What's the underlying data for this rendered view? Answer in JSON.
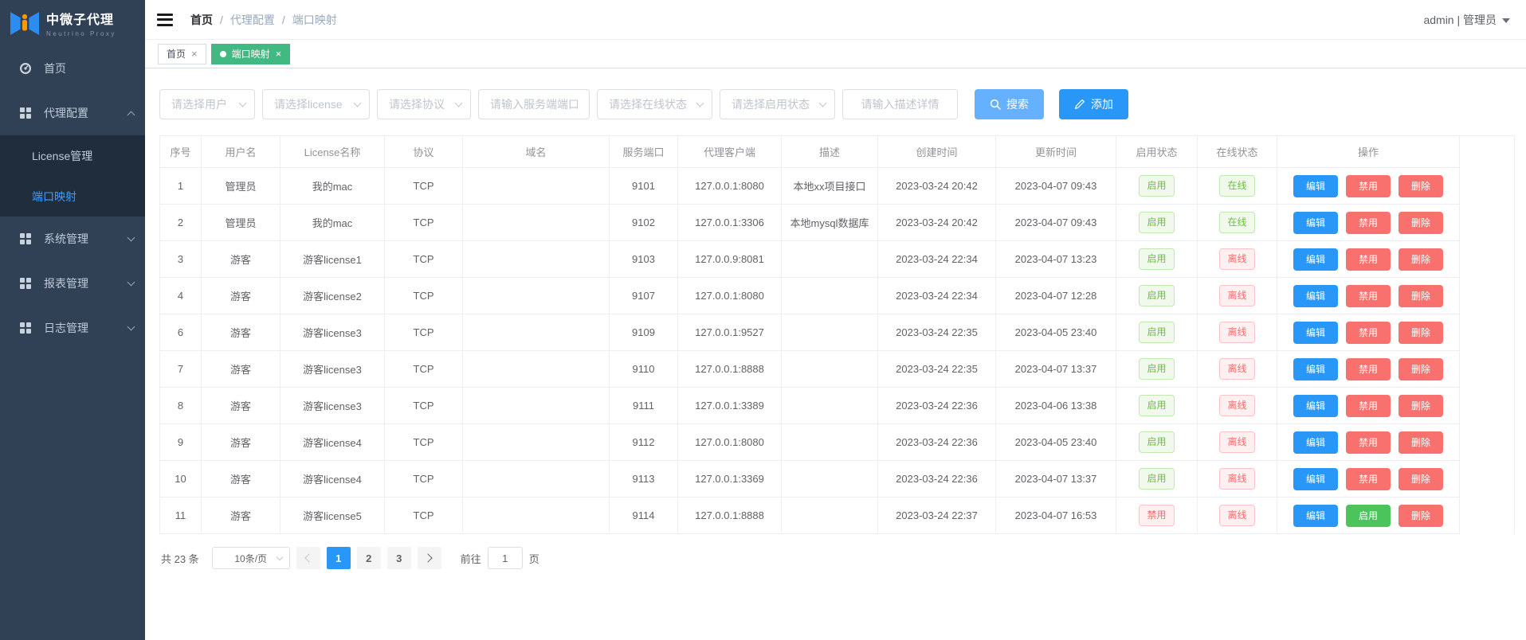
{
  "app": {
    "logo_title": "中微子代理",
    "logo_subtitle": "Neutrino Proxy",
    "user": "admin | 管理员"
  },
  "colors": {
    "sidebar_bg": "#304156",
    "submenu_bg": "#1f2d3d",
    "active_menu": "#409eff",
    "active_tab_green": "#42b983",
    "primary_blue": "#2997f7",
    "success_green": "#67c23a",
    "danger_red": "#f56c6c"
  },
  "sidebar": {
    "items": [
      {
        "label": "首页",
        "icon": "dashboard-icon"
      },
      {
        "label": "代理配置",
        "icon": "grid-icon",
        "children": [
          {
            "label": "License管理"
          },
          {
            "label": "端口映射"
          }
        ]
      },
      {
        "label": "系统管理",
        "icon": "grid-icon"
      },
      {
        "label": "报表管理",
        "icon": "grid-icon"
      },
      {
        "label": "日志管理",
        "icon": "grid-icon"
      }
    ]
  },
  "breadcrumb": {
    "items": [
      "首页",
      "代理配置",
      "端口映射"
    ],
    "separator": "/"
  },
  "tabs": [
    {
      "label": "首页",
      "close": "×"
    },
    {
      "label": "端口映射",
      "close": "×"
    }
  ],
  "filters": {
    "user_placeholder": "请选择用户",
    "license_placeholder": "请选择license",
    "protocol_placeholder": "请选择协议",
    "server_port_placeholder": "请输入服务端端口",
    "online_status_placeholder": "请选择在线状态",
    "enable_status_placeholder": "请选择启用状态",
    "description_placeholder": "请输入描述详情",
    "search_label": "搜索",
    "add_label": "添加"
  },
  "table": {
    "headers": [
      "序号",
      "用户名",
      "License名称",
      "协议",
      "域名",
      "服务端口",
      "代理客户端",
      "描述",
      "创建时间",
      "更新时间",
      "启用状态",
      "在线状态",
      "操作"
    ],
    "rows": [
      {
        "seq": "1",
        "user": "管理员",
        "license": "我的mac",
        "protocol": "TCP",
        "domain": "",
        "server_port": "9101",
        "client": "127.0.0.1:8080",
        "desc": "本地xx项目接口",
        "created": "2023-03-24 20:42",
        "updated": "2023-04-07 09:43",
        "enable_status": "启用",
        "enable_type": "green",
        "online_status": "在线",
        "online_type": "green",
        "actions": [
          {
            "label": "编辑",
            "type": "blue",
            "name": "edit"
          },
          {
            "label": "禁用",
            "type": "red",
            "name": "disable"
          },
          {
            "label": "删除",
            "type": "red",
            "name": "delete"
          }
        ]
      },
      {
        "seq": "2",
        "user": "管理员",
        "license": "我的mac",
        "protocol": "TCP",
        "domain": "",
        "server_port": "9102",
        "client": "127.0.0.1:3306",
        "desc": "本地mysql数据库",
        "created": "2023-03-24 20:42",
        "updated": "2023-04-07 09:43",
        "enable_status": "启用",
        "enable_type": "green",
        "online_status": "在线",
        "online_type": "green",
        "actions": [
          {
            "label": "编辑",
            "type": "blue",
            "name": "edit"
          },
          {
            "label": "禁用",
            "type": "red",
            "name": "disable"
          },
          {
            "label": "删除",
            "type": "red",
            "name": "delete"
          }
        ]
      },
      {
        "seq": "3",
        "user": "游客",
        "license": "游客license1",
        "protocol": "TCP",
        "domain": "",
        "server_port": "9103",
        "client": "127.0.0.9:8081",
        "desc": "",
        "created": "2023-03-24 22:34",
        "updated": "2023-04-07 13:23",
        "enable_status": "启用",
        "enable_type": "green",
        "online_status": "离线",
        "online_type": "red",
        "actions": [
          {
            "label": "编辑",
            "type": "blue",
            "name": "edit"
          },
          {
            "label": "禁用",
            "type": "red",
            "name": "disable"
          },
          {
            "label": "删除",
            "type": "red",
            "name": "delete"
          }
        ]
      },
      {
        "seq": "4",
        "user": "游客",
        "license": "游客license2",
        "protocol": "TCP",
        "domain": "",
        "server_port": "9107",
        "client": "127.0.0.1:8080",
        "desc": "",
        "created": "2023-03-24 22:34",
        "updated": "2023-04-07 12:28",
        "enable_status": "启用",
        "enable_type": "green",
        "online_status": "离线",
        "online_type": "red",
        "actions": [
          {
            "label": "编辑",
            "type": "blue",
            "name": "edit"
          },
          {
            "label": "禁用",
            "type": "red",
            "name": "disable"
          },
          {
            "label": "删除",
            "type": "red",
            "name": "delete"
          }
        ]
      },
      {
        "seq": "6",
        "user": "游客",
        "license": "游客license3",
        "protocol": "TCP",
        "domain": "",
        "server_port": "9109",
        "client": "127.0.0.1:9527",
        "desc": "",
        "created": "2023-03-24 22:35",
        "updated": "2023-04-05 23:40",
        "enable_status": "启用",
        "enable_type": "green",
        "online_status": "离线",
        "online_type": "red",
        "actions": [
          {
            "label": "编辑",
            "type": "blue",
            "name": "edit"
          },
          {
            "label": "禁用",
            "type": "red",
            "name": "disable"
          },
          {
            "label": "删除",
            "type": "red",
            "name": "delete"
          }
        ]
      },
      {
        "seq": "7",
        "user": "游客",
        "license": "游客license3",
        "protocol": "TCP",
        "domain": "",
        "server_port": "9110",
        "client": "127.0.0.1:8888",
        "desc": "",
        "created": "2023-03-24 22:35",
        "updated": "2023-04-07 13:37",
        "enable_status": "启用",
        "enable_type": "green",
        "online_status": "离线",
        "online_type": "red",
        "actions": [
          {
            "label": "编辑",
            "type": "blue",
            "name": "edit"
          },
          {
            "label": "禁用",
            "type": "red",
            "name": "disable"
          },
          {
            "label": "删除",
            "type": "red",
            "name": "delete"
          }
        ]
      },
      {
        "seq": "8",
        "user": "游客",
        "license": "游客license3",
        "protocol": "TCP",
        "domain": "",
        "server_port": "9111",
        "client": "127.0.0.1:3389",
        "desc": "",
        "created": "2023-03-24 22:36",
        "updated": "2023-04-06 13:38",
        "enable_status": "启用",
        "enable_type": "green",
        "online_status": "离线",
        "online_type": "red",
        "actions": [
          {
            "label": "编辑",
            "type": "blue",
            "name": "edit"
          },
          {
            "label": "禁用",
            "type": "red",
            "name": "disable"
          },
          {
            "label": "删除",
            "type": "red",
            "name": "delete"
          }
        ]
      },
      {
        "seq": "9",
        "user": "游客",
        "license": "游客license4",
        "protocol": "TCP",
        "domain": "",
        "server_port": "9112",
        "client": "127.0.0.1:8080",
        "desc": "",
        "created": "2023-03-24 22:36",
        "updated": "2023-04-05 23:40",
        "enable_status": "启用",
        "enable_type": "green",
        "online_status": "离线",
        "online_type": "red",
        "actions": [
          {
            "label": "编辑",
            "type": "blue",
            "name": "edit"
          },
          {
            "label": "禁用",
            "type": "red",
            "name": "disable"
          },
          {
            "label": "删除",
            "type": "red",
            "name": "delete"
          }
        ]
      },
      {
        "seq": "10",
        "user": "游客",
        "license": "游客license4",
        "protocol": "TCP",
        "domain": "",
        "server_port": "9113",
        "client": "127.0.0.1:3369",
        "desc": "",
        "created": "2023-03-24 22:36",
        "updated": "2023-04-07 13:37",
        "enable_status": "启用",
        "enable_type": "green",
        "online_status": "离线",
        "online_type": "red",
        "actions": [
          {
            "label": "编辑",
            "type": "blue",
            "name": "edit"
          },
          {
            "label": "禁用",
            "type": "red",
            "name": "disable"
          },
          {
            "label": "删除",
            "type": "red",
            "name": "delete"
          }
        ]
      },
      {
        "seq": "11",
        "user": "游客",
        "license": "游客license5",
        "protocol": "TCP",
        "domain": "",
        "server_port": "9114",
        "client": "127.0.0.1:8888",
        "desc": "",
        "created": "2023-03-24 22:37",
        "updated": "2023-04-07 16:53",
        "enable_status": "禁用",
        "enable_type": "red",
        "online_status": "离线",
        "online_type": "red",
        "actions": [
          {
            "label": "编辑",
            "type": "blue",
            "name": "edit"
          },
          {
            "label": "启用",
            "type": "green",
            "name": "enable"
          },
          {
            "label": "删除",
            "type": "red",
            "name": "delete"
          }
        ]
      }
    ]
  },
  "pagination": {
    "total_label": "共 23 条",
    "page_size": "10条/页",
    "pages": [
      "1",
      "2",
      "3"
    ],
    "active_page": "1",
    "goto_label": "前往",
    "goto_value": "1",
    "goto_suffix": "页"
  }
}
